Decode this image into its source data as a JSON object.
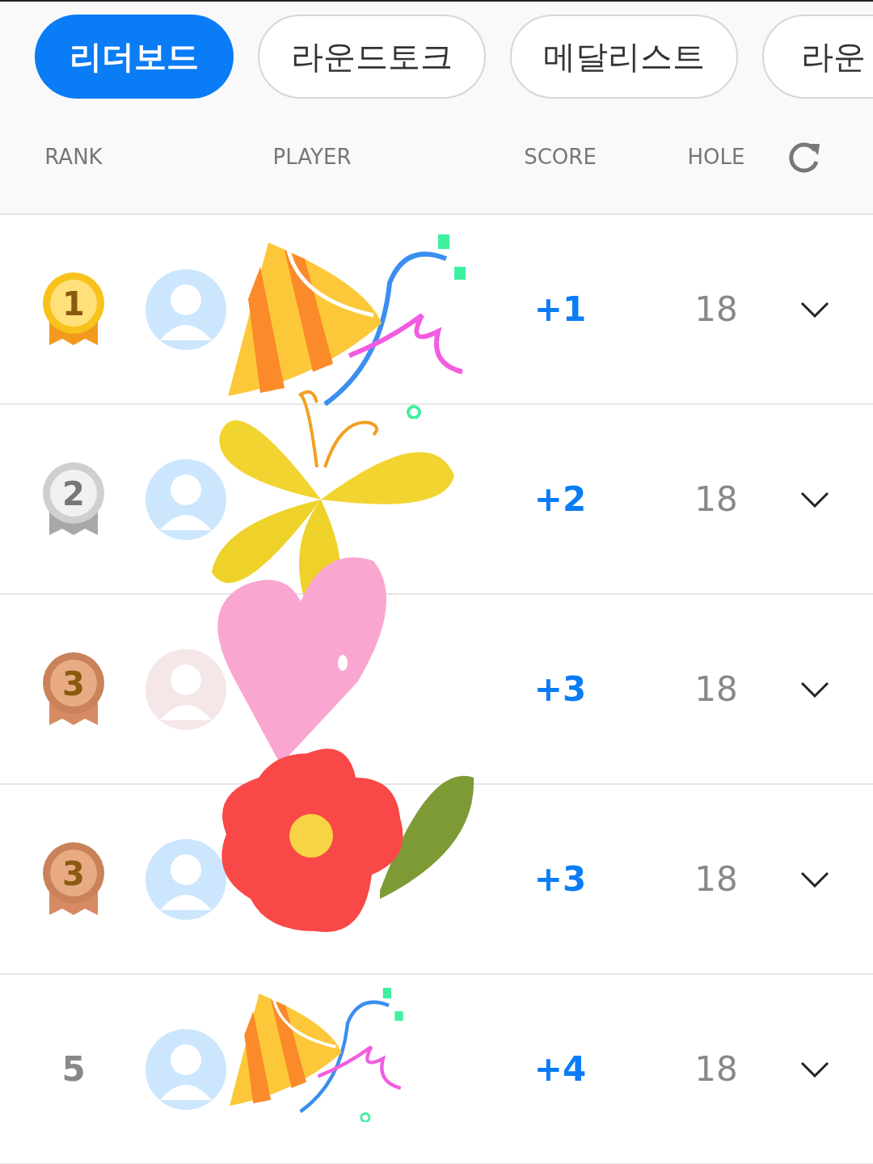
{
  "tabs": [
    {
      "label": "리더보드",
      "selected": true
    },
    {
      "label": "라운드토크",
      "selected": false
    },
    {
      "label": "메달리스트",
      "selected": false
    },
    {
      "label": "라운",
      "selected": false
    }
  ],
  "columns": {
    "rank": "RANK",
    "player": "PLAYER",
    "score": "SCORE",
    "hole": "HOLE"
  },
  "rows": [
    {
      "rank": "1",
      "kind": "gold",
      "color": "#cce6fd",
      "score": "+1",
      "hole": "18",
      "expanded": false
    },
    {
      "rank": "2",
      "kind": "silver",
      "color": "#cce6fd",
      "score": "+2",
      "hole": "18",
      "expanded": false
    },
    {
      "rank": "3",
      "kind": "bronze",
      "color": "#f5e6e8",
      "score": "+3",
      "hole": "18",
      "expanded": false
    },
    {
      "rank": "3",
      "kind": "bronze",
      "color": "#cce6fd",
      "score": "+3",
      "hole": "18",
      "expanded": false
    },
    {
      "rank": "5",
      "kind": "plain",
      "color": "#cce6fd",
      "score": "+4",
      "hole": "18",
      "expanded": false
    }
  ]
}
